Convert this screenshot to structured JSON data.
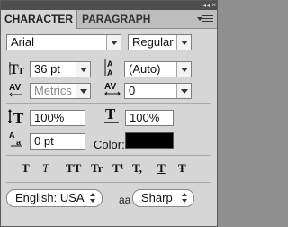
{
  "tabs": [
    "CHARACTER",
    "PARAGRAPH"
  ],
  "title_bar": {
    "collapse_glyph": "◂◂",
    "close_glyph": "×"
  },
  "font": {
    "family": "Arial",
    "style": "Regular"
  },
  "size": {
    "font_size": "36 pt",
    "leading": "(Auto)"
  },
  "spacing": {
    "kerning": "Metrics",
    "tracking": "0"
  },
  "scale": {
    "vertical": "100%",
    "horizontal": "100%"
  },
  "baseline": {
    "shift": "0 pt"
  },
  "color": {
    "label": "Color:",
    "swatch": "#000000"
  },
  "type_styles": [
    "T",
    "T",
    "TT",
    "Tr",
    "T¹",
    "T,",
    "T",
    "Ŧ"
  ],
  "bottom": {
    "language": "English: USA",
    "antialias_icon_text": "aa",
    "antialias": "Sharp"
  },
  "icons": {
    "font_size": "font-size-icon",
    "leading": "leading-icon",
    "kerning": "kerning-icon",
    "tracking": "tracking-icon",
    "vertical_scale": "vertical-scale-icon",
    "horizontal_scale": "horizontal-scale-icon",
    "baseline_shift": "baseline-shift-icon"
  }
}
